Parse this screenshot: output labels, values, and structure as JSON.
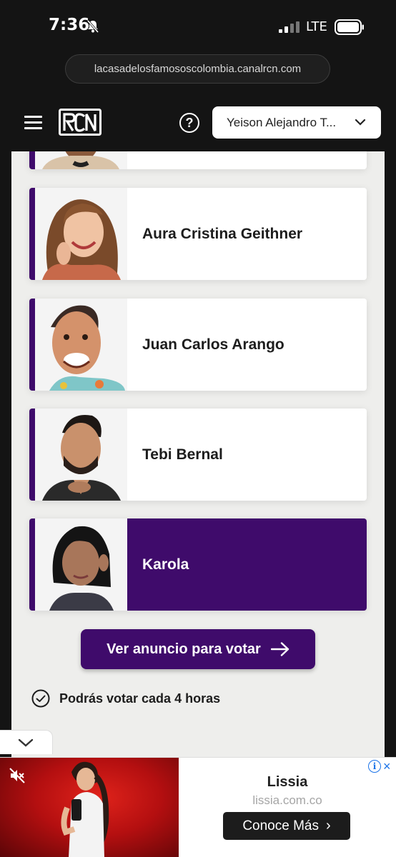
{
  "status": {
    "time": "7:36",
    "network": "LTE"
  },
  "browser": {
    "url": "lacasadelosfamososcolombia.canalrcn.com"
  },
  "header": {
    "help_symbol": "?",
    "selected_contestant": "Yeison Alejandro T..."
  },
  "contestants": [
    {
      "name": "Aura Cristina Geithner"
    },
    {
      "name": "Juan Carlos Arango"
    },
    {
      "name": "Tebi Bernal"
    },
    {
      "name": "Karola"
    }
  ],
  "vote": {
    "button_label": "Ver anuncio para votar",
    "notice": "Podrás votar cada 4 horas"
  },
  "ad": {
    "title": "Lissia",
    "url": "lissia.com.co",
    "cta": "Conoce Más",
    "cta_chevron": "›",
    "info_symbol": "i",
    "close_symbol": "×"
  },
  "colors": {
    "brand_purple": "#3f0b6b",
    "background": "#eeeeec",
    "ad_red": "#c4151a"
  }
}
